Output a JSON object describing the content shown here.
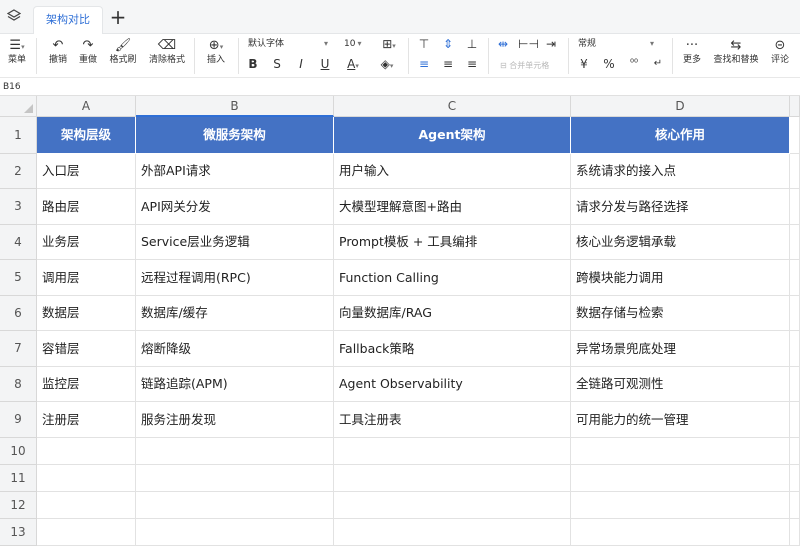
{
  "tabbar": {
    "tab_label": "架构对比",
    "add_label": "+"
  },
  "toolbar": {
    "menu": "菜单",
    "undo": "撤销",
    "redo": "重做",
    "format_painter": "格式刷",
    "clear_format": "清除格式",
    "insert": "插入",
    "font_name": "默认字体",
    "font_size": "10",
    "bold": "B",
    "italic": "I",
    "strikethrough": "S",
    "underline": "U",
    "font_color": "A",
    "merge_cells": "合并单元格",
    "number_format": "常规",
    "currency": "¥",
    "percent": "%",
    "more": "更多",
    "find_replace": "查找和替换",
    "comment": "评论"
  },
  "formula_bar": {
    "cell_ref": "B16"
  },
  "sheet": {
    "columns": [
      "A",
      "B",
      "C",
      "D"
    ],
    "row_numbers": [
      "1",
      "2",
      "3",
      "4",
      "5",
      "6",
      "7",
      "8",
      "9",
      "10",
      "11",
      "12",
      "13"
    ],
    "rows": [
      [
        "架构层级",
        "微服务架构",
        "Agent架构",
        "核心作用"
      ],
      [
        "入口层",
        "外部API请求",
        "用户输入",
        "系统请求的接入点"
      ],
      [
        "路由层",
        "API网关分发",
        "大模型理解意图+路由",
        "请求分发与路径选择"
      ],
      [
        "业务层",
        "Service层业务逻辑",
        "Prompt模板 + 工具编排",
        "核心业务逻辑承载"
      ],
      [
        "调用层",
        "远程过程调用(RPC)",
        "Function Calling",
        "跨模块能力调用"
      ],
      [
        "数据层",
        "数据库/缓存",
        "向量数据库/RAG",
        "数据存储与检索"
      ],
      [
        "容错层",
        "熔断降级",
        "Fallback策略",
        "异常场景兜底处理"
      ],
      [
        "监控层",
        "链路追踪(APM)",
        "Agent Observability",
        "全链路可观测性"
      ],
      [
        "注册层",
        "服务注册发现",
        "工具注册表",
        "可用能力的统一管理"
      ],
      [
        "",
        "",
        "",
        ""
      ],
      [
        "",
        "",
        "",
        ""
      ],
      [
        "",
        "",
        "",
        ""
      ],
      [
        "",
        "",
        "",
        ""
      ]
    ]
  },
  "colors": {
    "header_fill": "#4472c4",
    "header_text": "#ffffff",
    "accent": "#2f6fd6"
  }
}
